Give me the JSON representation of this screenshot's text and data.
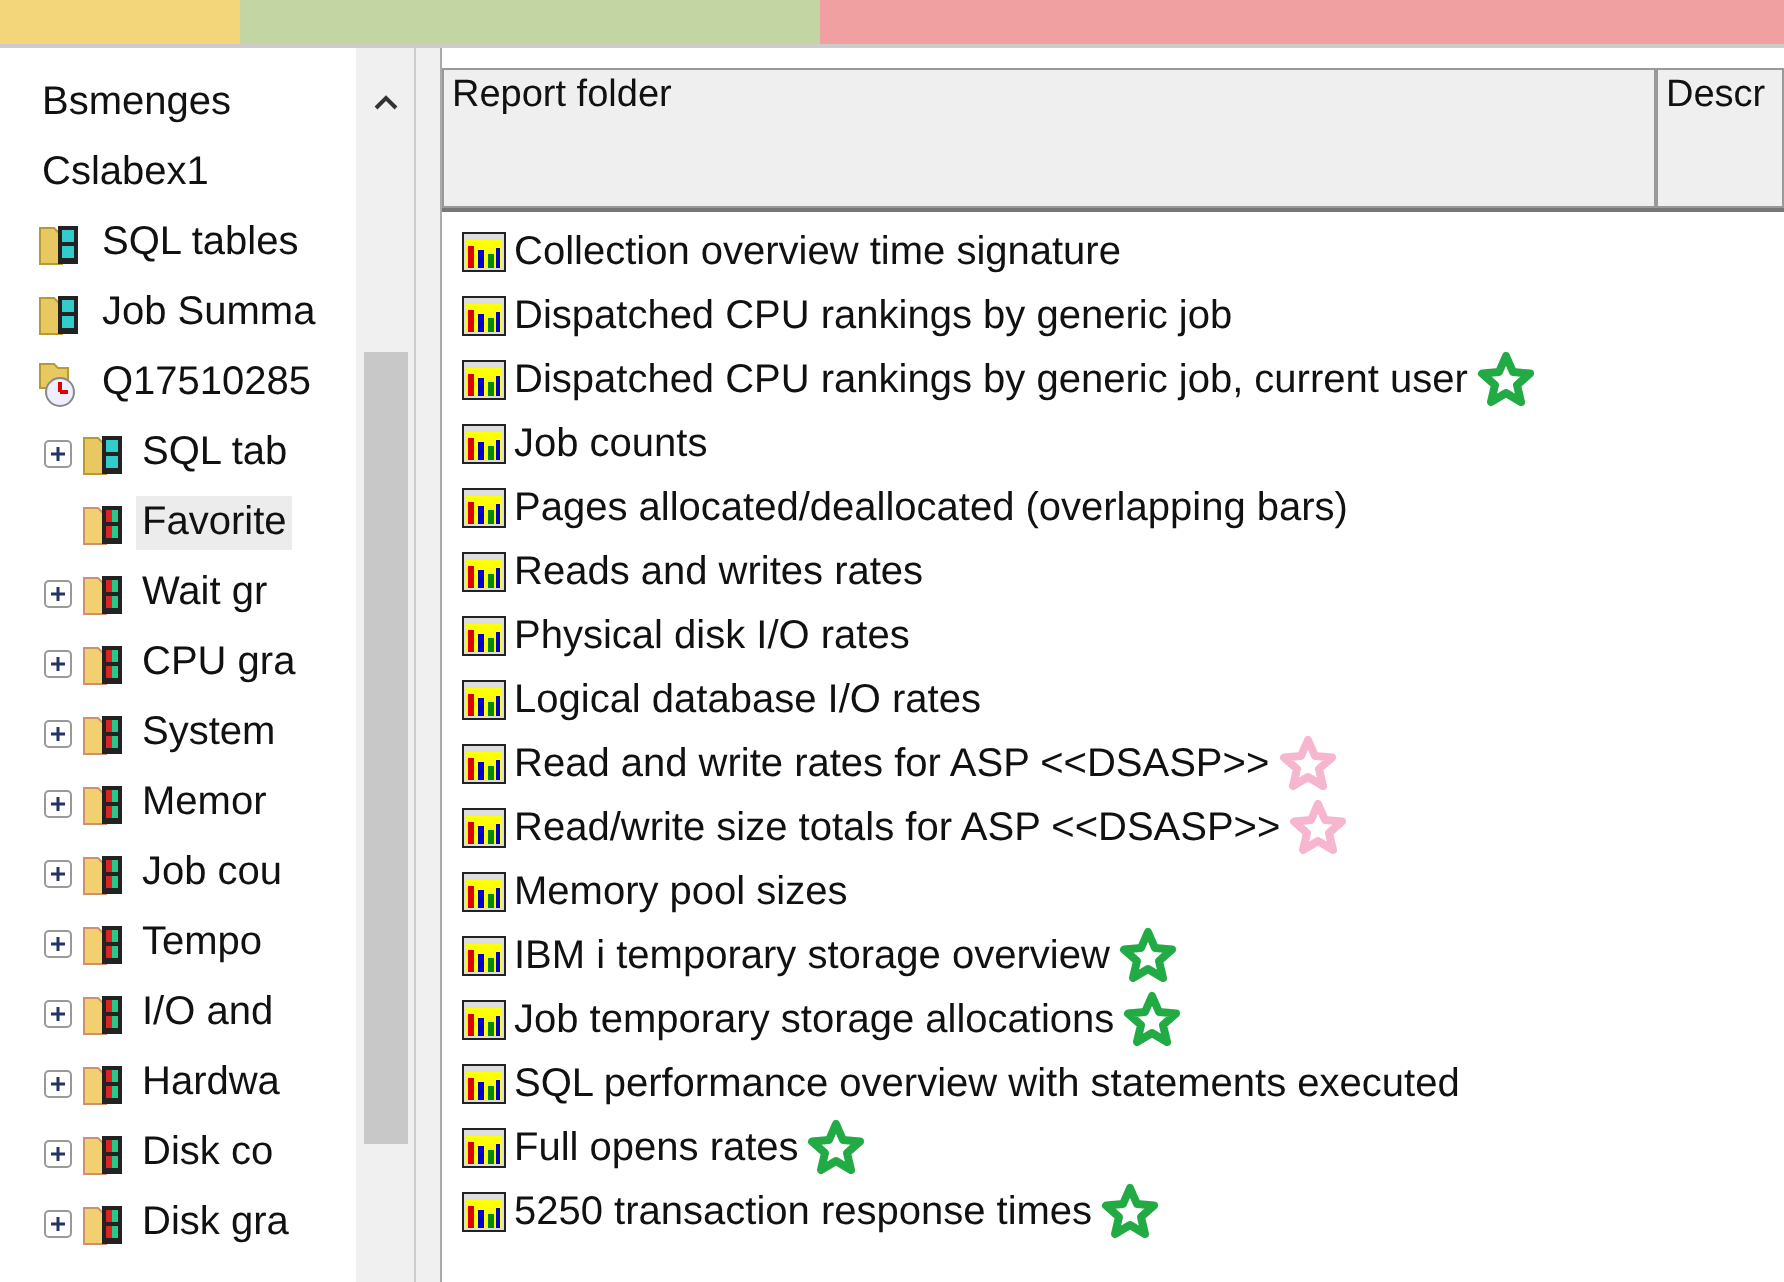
{
  "tabs": [
    {
      "color": "#f3d57a"
    },
    {
      "color": "#c3d5a2"
    },
    {
      "color": "#f0a0a0"
    }
  ],
  "tree": [
    {
      "label": "Bsmenges",
      "kind": "plain",
      "selected": false
    },
    {
      "label": "Cslabex1",
      "kind": "plain",
      "selected": false
    },
    {
      "label": "SQL tables",
      "kind": "tables",
      "selected": false
    },
    {
      "label": "Job Summa",
      "kind": "tables",
      "selected": false
    },
    {
      "label": "Q17510285",
      "kind": "collection",
      "selected": false,
      "children": [
        {
          "label": "SQL tab",
          "kind": "tables",
          "selected": false,
          "expandable": true
        },
        {
          "label": "Favorite",
          "kind": "graphs",
          "selected": true,
          "expandable": false
        },
        {
          "label": "Wait gr",
          "kind": "graphs",
          "selected": false,
          "expandable": true
        },
        {
          "label": "CPU gra",
          "kind": "graphs",
          "selected": false,
          "expandable": true
        },
        {
          "label": "System",
          "kind": "graphs",
          "selected": false,
          "expandable": true
        },
        {
          "label": "Memor",
          "kind": "graphs",
          "selected": false,
          "expandable": true
        },
        {
          "label": "Job cou",
          "kind": "graphs",
          "selected": false,
          "expandable": true
        },
        {
          "label": "Tempo",
          "kind": "graphs",
          "selected": false,
          "expandable": true
        },
        {
          "label": "I/O and",
          "kind": "graphs",
          "selected": false,
          "expandable": true
        },
        {
          "label": "Hardwa",
          "kind": "graphs",
          "selected": false,
          "expandable": true
        },
        {
          "label": "Disk co",
          "kind": "graphs",
          "selected": false,
          "expandable": true
        },
        {
          "label": "Disk gra",
          "kind": "graphs",
          "selected": false,
          "expandable": true
        }
      ]
    }
  ],
  "table": {
    "columns": [
      "Report folder",
      "Descr"
    ],
    "rows": [
      {
        "label": "Collection overview time signature"
      },
      {
        "label": "Dispatched CPU rankings by generic job"
      },
      {
        "label": "Dispatched CPU rankings by generic job, current user",
        "color": "#22aa44"
      },
      {
        "label": "Job counts"
      },
      {
        "label": "Pages allocated/deallocated (overlapping bars)"
      },
      {
        "label": "Reads and writes rates"
      },
      {
        "label": "Physical disk I/O rates"
      },
      {
        "label": "Logical database I/O rates"
      },
      {
        "label": "Read and write rates for ASP <<DSASP>>",
        "color": "#f7b6cf"
      },
      {
        "label": "Read/write size totals for ASP <<DSASP>>",
        "color": "#f7b6cf"
      },
      {
        "label": "Memory pool sizes"
      },
      {
        "label": "IBM i temporary storage overview",
        "color": "#22aa44"
      },
      {
        "label": "Job temporary storage allocations",
        "color": "#22aa44"
      },
      {
        "label": "SQL performance overview with statements executed"
      },
      {
        "label": "Full opens rates",
        "color": "#22aa44"
      },
      {
        "label": "5250 transaction response times",
        "color": "#22aa44"
      }
    ]
  }
}
